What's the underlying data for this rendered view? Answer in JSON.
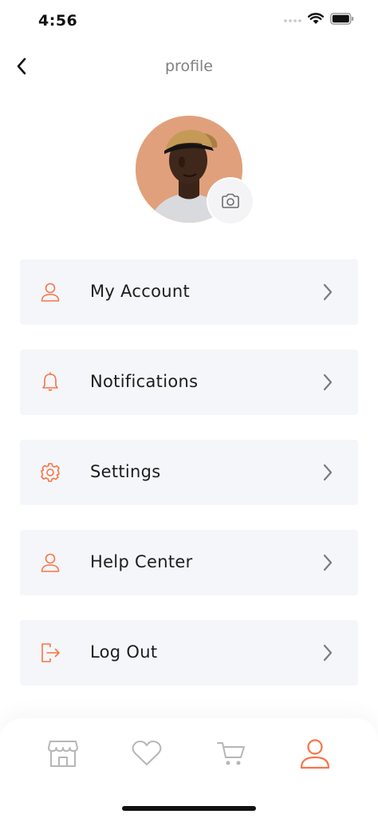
{
  "status_bar": {
    "time": "4:56"
  },
  "header": {
    "title": "profile"
  },
  "menu": {
    "items": [
      {
        "label": "My Account",
        "icon": "user-icon"
      },
      {
        "label": "Notifications",
        "icon": "bell-icon"
      },
      {
        "label": "Settings",
        "icon": "gear-icon"
      },
      {
        "label": "Help Center",
        "icon": "user-icon"
      },
      {
        "label": "Log Out",
        "icon": "logout-icon"
      }
    ]
  },
  "tab_bar": {
    "tabs": [
      {
        "icon": "shop-icon",
        "active": false
      },
      {
        "icon": "heart-icon",
        "active": false
      },
      {
        "icon": "cart-icon",
        "active": false
      },
      {
        "icon": "user-icon",
        "active": true
      }
    ]
  },
  "colors": {
    "accent": "#F77547",
    "inactive_icon": "#B6B6B6",
    "menu_bg": "#F5F6F9",
    "title_gray": "#808080"
  }
}
